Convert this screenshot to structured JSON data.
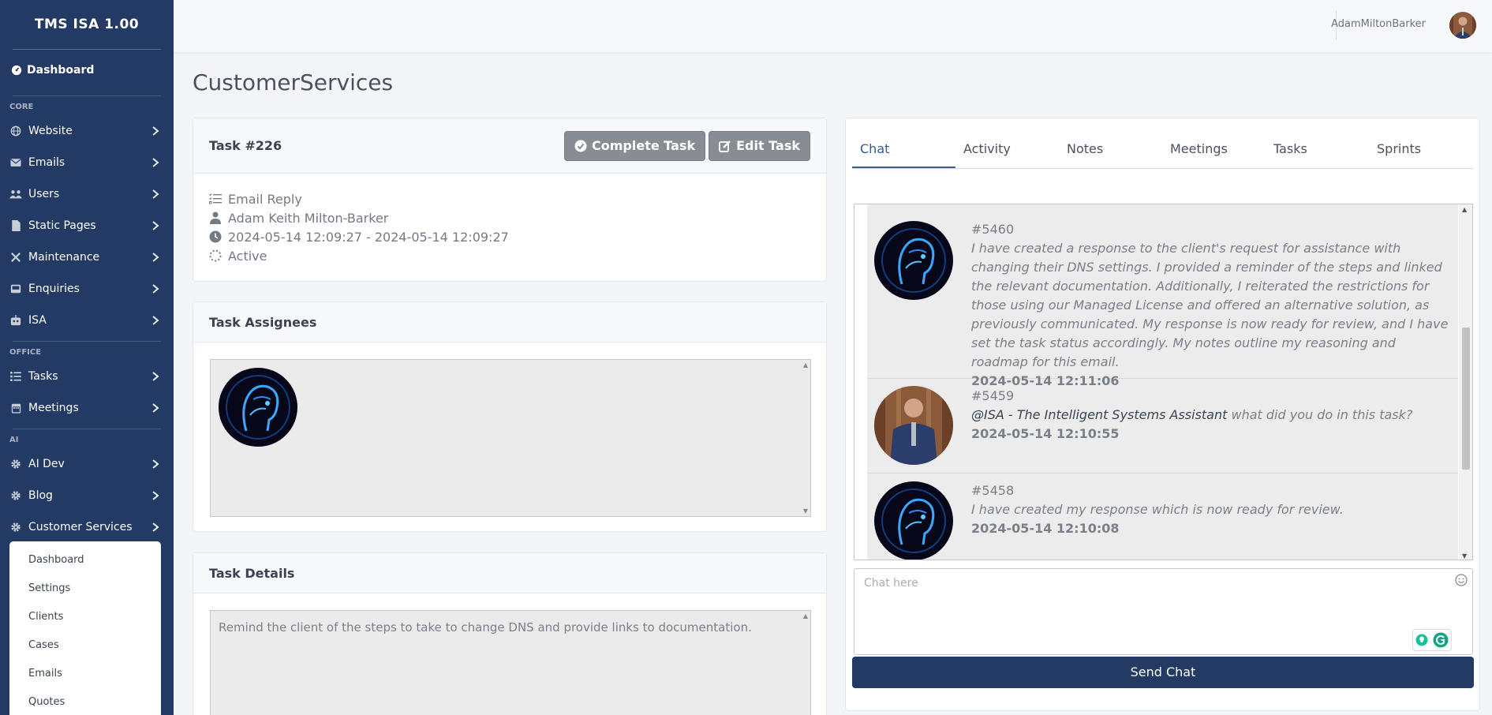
{
  "app": {
    "title": "TMS ISA 1.00"
  },
  "sidebar": {
    "dashboard_label": "Dashboard",
    "sections": [
      {
        "heading": "CORE",
        "items": [
          {
            "label": "Website",
            "icon": "globe-icon"
          },
          {
            "label": "Emails",
            "icon": "envelope-icon"
          },
          {
            "label": "Users",
            "icon": "users-icon"
          },
          {
            "label": "Static Pages",
            "icon": "file-icon"
          },
          {
            "label": "Maintenance",
            "icon": "tools-icon"
          },
          {
            "label": "Enquiries",
            "icon": "inbox-icon"
          },
          {
            "label": "ISA",
            "icon": "robot-icon"
          }
        ]
      },
      {
        "heading": "OFFICE",
        "items": [
          {
            "label": "Tasks",
            "icon": "list-icon"
          },
          {
            "label": "Meetings",
            "icon": "calendar-icon"
          }
        ]
      },
      {
        "heading": "AI",
        "items": [
          {
            "label": "AI Dev",
            "icon": "gear-icon"
          },
          {
            "label": "Blog",
            "icon": "gear-icon"
          },
          {
            "label": "Customer Services",
            "icon": "gear-icon"
          }
        ]
      }
    ],
    "submenu": [
      "Dashboard",
      "Settings",
      "Clients",
      "Cases",
      "Emails",
      "Quotes"
    ]
  },
  "topbar": {
    "username": "AdamMiltonBarker"
  },
  "page": {
    "title": "CustomerServices"
  },
  "task": {
    "title": "Task #226",
    "complete_label": "Complete Task",
    "edit_label": "Edit Task",
    "type": "Email Reply",
    "owner": "Adam Keith Milton-Barker",
    "dates": "2024-05-14 12:09:27 - 2024-05-14 12:09:27",
    "status": "Active"
  },
  "assignees": {
    "title": "Task Assignees"
  },
  "details": {
    "title": "Task Details",
    "text": "Remind the client of the steps to take to change DNS and provide links to documentation."
  },
  "tabs": [
    "Chat",
    "Activity",
    "Notes",
    "Meetings",
    "Tasks",
    "Sprints"
  ],
  "chat": {
    "messages": [
      {
        "id": "#5460",
        "text": "I have created a response to the client's request for assistance with changing their DNS settings. I provided a reminder of the steps and linked the relevant documentation. Additionally, I reiterated the restrictions for those using our Managed License and offered an alternative solution, as previously communicated. My response is now ready for review, and I have set the task status accordingly. My notes outline my reasoning and roadmap for this email.",
        "time": "2024-05-14 12:11:06",
        "avatar": "ai-avatar"
      },
      {
        "id": "#5459",
        "mention": "@ISA - The Intelligent Systems Assistant",
        "text": " what did you do in this task?",
        "time": "2024-05-14 12:10:55",
        "avatar": "user-avatar"
      },
      {
        "id": "#5458",
        "text": "I have created my response which is now ready for review.",
        "time": "2024-05-14 12:10:08",
        "avatar": "ai-avatar"
      }
    ],
    "placeholder": "Chat here",
    "send_label": "Send Chat"
  },
  "colors": {
    "sidebar": "#233b64",
    "accent": "#355a90",
    "button": "#888d94"
  }
}
